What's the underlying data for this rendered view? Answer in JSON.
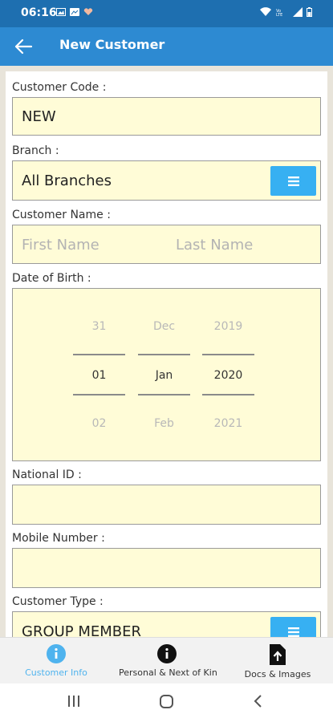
{
  "status_bar": {
    "time": "06:16"
  },
  "app_bar": {
    "title": "New Customer"
  },
  "form": {
    "customer_code": {
      "label": "Customer Code :",
      "value": "NEW"
    },
    "branch": {
      "label": "Branch :",
      "value": "All Branches"
    },
    "customer_name": {
      "label": "Customer Name :",
      "first_placeholder": "First Name",
      "last_placeholder": "Last Name"
    },
    "date_of_birth": {
      "label": "Date of Birth :",
      "day": {
        "prev": "31",
        "selected": "01",
        "next": "02"
      },
      "month": {
        "prev": "Dec",
        "selected": "Jan",
        "next": "Feb"
      },
      "year": {
        "prev": "2019",
        "selected": "2020",
        "next": "2021"
      }
    },
    "national_id": {
      "label": "National ID :",
      "value": ""
    },
    "mobile_number": {
      "label": "Mobile Number :",
      "value": ""
    },
    "customer_type": {
      "label": "Customer Type :",
      "value": "GROUP MEMBER"
    }
  },
  "bottom_nav": {
    "items": [
      {
        "label": "Customer Info",
        "icon": "info-icon",
        "active": true
      },
      {
        "label": "Personal & Next of Kin",
        "icon": "info-icon",
        "active": false
      },
      {
        "label": "Docs & Images",
        "icon": "upload-file-icon",
        "active": false
      }
    ]
  },
  "colors": {
    "app_bar": "#2d8ad2",
    "status_bar": "#1e6fb0",
    "field_bg": "#fffcd7",
    "accent": "#37b0f2",
    "active_nav": "#4fb3ee"
  }
}
